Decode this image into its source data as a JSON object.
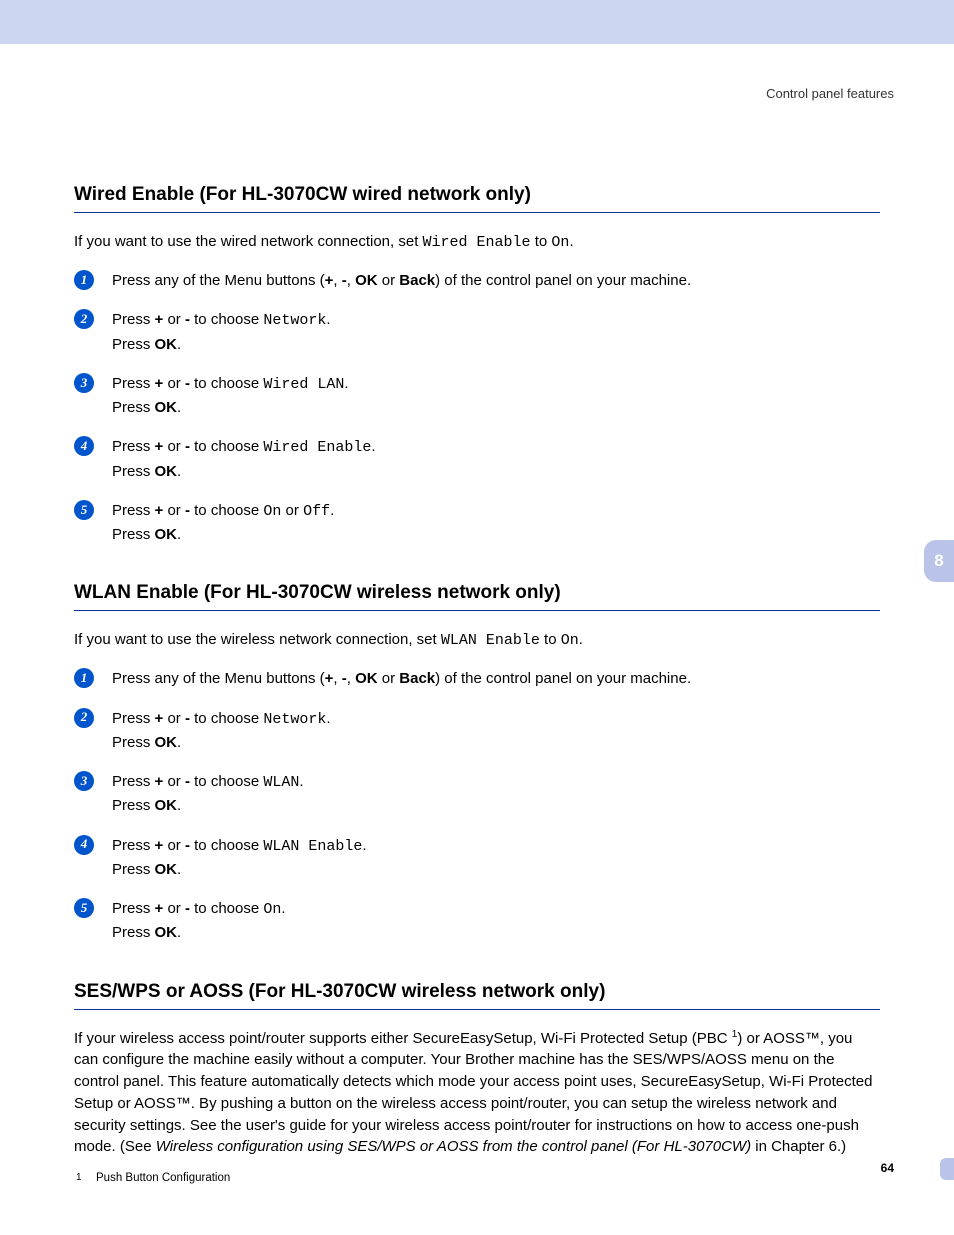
{
  "header": {
    "right_text": "Control panel features"
  },
  "chapter_tab": "8",
  "page_number": "64",
  "sections": [
    {
      "title": "Wired Enable (For HL-3070CW wired network only)",
      "intro_pre": "If you want to use the wired network connection, set ",
      "intro_code": "Wired Enable",
      "intro_mid": " to ",
      "intro_code2": "On",
      "intro_post": ".",
      "steps": [
        {
          "html": "Press any of the Menu buttons (<b>+</b>, <b>-</b>, <b>OK</b> or <b>Back</b>) of the control panel on your machine."
        },
        {
          "html": "Press <b>+</b> or <b>-</b> to choose <span class='mono'>Network</span>.<br>Press <b>OK</b>."
        },
        {
          "html": "Press <b>+</b> or <b>-</b> to choose <span class='mono'>Wired LAN</span>.<br>Press <b>OK</b>."
        },
        {
          "html": "Press <b>+</b> or <b>-</b> to choose <span class='mono'>Wired Enable</span>.<br>Press <b>OK</b>."
        },
        {
          "html": "Press <b>+</b> or <b>-</b> to choose <span class='mono'>On</span> or <span class='mono'>Off</span>.<br>Press <b>OK</b>."
        }
      ]
    },
    {
      "title": "WLAN Enable (For HL-3070CW wireless network only)",
      "intro_pre": "If you want to use the wireless network connection, set ",
      "intro_code": "WLAN Enable",
      "intro_mid": " to ",
      "intro_code2": "On",
      "intro_post": ".",
      "steps": [
        {
          "html": "Press any of the Menu buttons (<b>+</b>, <b>-</b>, <b>OK</b> or <b>Back</b>) of the control panel on your machine."
        },
        {
          "html": "Press <b>+</b> or <b>-</b> to choose <span class='mono'>Network</span>.<br>Press <b>OK</b>."
        },
        {
          "html": "Press <b>+</b> or <b>-</b> to choose <span class='mono'>WLAN</span>.<br>Press <b>OK</b>."
        },
        {
          "html": "Press <b>+</b> or <b>-</b> to choose <span class='mono'>WLAN Enable</span>.<br>Press <b>OK</b>."
        },
        {
          "html": "Press <b>+</b> or <b>-</b> to choose <span class='mono'>On</span>.<br>Press <b>OK</b>."
        }
      ]
    },
    {
      "title": "SES/WPS or AOSS (For HL-3070CW wireless network only)",
      "paragraph_html": "If your wireless access point/router supports either SecureEasySetup, Wi-Fi Protected Setup (PBC <sup>1</sup>) or AOSS™, you can configure the machine easily without a computer. Your Brother machine has the SES/WPS/AOSS menu on the control panel. This feature automatically detects which mode your access point uses, SecureEasySetup, Wi-Fi Protected Setup or AOSS™. By pushing a button on the wireless access point/router, you can setup the wireless network and security settings. See the user's guide for your wireless access point/router for instructions on how to access one-push mode. (See <span class='italic'>Wireless configuration using SES/WPS or AOSS from the control panel (For HL-3070CW)</span> in Chapter 6.)",
      "footnote_num": "1",
      "footnote_text": "Push Button Configuration"
    }
  ]
}
